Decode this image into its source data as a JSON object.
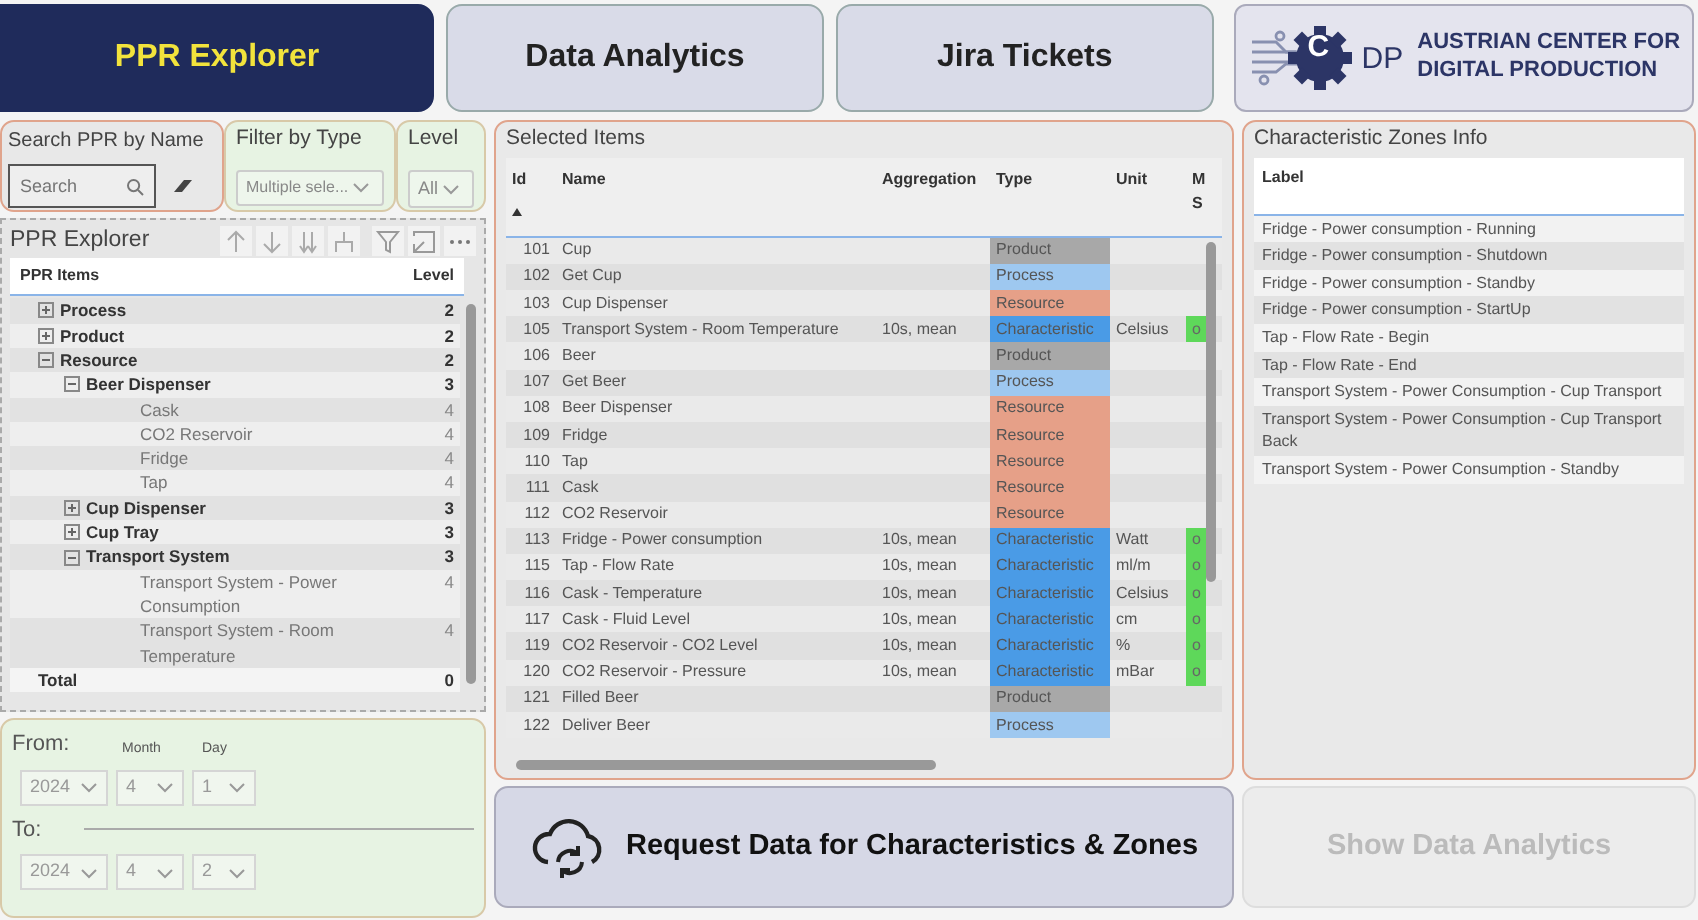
{
  "nav_tabs": [
    {
      "label": "PPR Explorer",
      "selected": true
    },
    {
      "label": "Data Analytics",
      "selected": false
    },
    {
      "label": "Jira Tickets",
      "selected": false
    }
  ],
  "logo": {
    "mark_letter": "C",
    "mark_suffix": "DP",
    "line_1": "AUSTRIAN CENTER FOR",
    "line_2": "DIGITAL PRODUCTION"
  },
  "filters": {
    "search": {
      "title": "Search PPR by Name",
      "placeholder": "Search"
    },
    "type_filter": {
      "title": "Filter by Type",
      "value": "Multiple sele..."
    },
    "level_filter": {
      "title": "Level",
      "value": "All"
    }
  },
  "ppr_explorer": {
    "title": "PPR Explorer",
    "columns": [
      "PPR Items",
      "Level"
    ],
    "rows": [
      {
        "label": "Process",
        "level": "2",
        "expanded": false
      },
      {
        "label": "Product",
        "level": "2",
        "expanded": false
      },
      {
        "label": "Resource",
        "level": "2",
        "expanded": true,
        "children": [
          {
            "label": "Beer Dispenser",
            "level": "3",
            "expanded": true,
            "children": [
              {
                "label": "Cask",
                "level": "4"
              },
              {
                "label": "CO2 Reservoir",
                "level": "4"
              },
              {
                "label": "Fridge",
                "level": "4"
              },
              {
                "label": "Tap",
                "level": "4"
              }
            ]
          },
          {
            "label": "Cup Dispenser",
            "level": "3",
            "expanded": false
          },
          {
            "label": "Cup Tray",
            "level": "3",
            "expanded": false
          },
          {
            "label": "Transport System",
            "level": "3",
            "expanded": true,
            "children": [
              {
                "label": "Transport System - Power Consumption",
                "level": "4"
              },
              {
                "label": "Transport System - Room Temperature",
                "level": "4"
              }
            ]
          }
        ]
      }
    ],
    "total": {
      "label": "Total",
      "level": "0"
    }
  },
  "date_range": {
    "from_label": "From:",
    "month_label": "Month",
    "day_label": "Day",
    "from": {
      "year": "2024",
      "month": "4",
      "day": "1"
    },
    "to_label": "To:",
    "to": {
      "year": "2024",
      "month": "4",
      "day": "2"
    }
  },
  "selected_items": {
    "title": "Selected Items",
    "columns": [
      "Id",
      "Name",
      "Aggregation",
      "Type",
      "Unit",
      "M S"
    ],
    "rows": [
      {
        "id": "101",
        "name": "Cup",
        "type": "Product",
        "kind": "product"
      },
      {
        "id": "102",
        "name": "Get Cup",
        "type": "Process",
        "kind": "process"
      },
      {
        "id": "103",
        "name": "Cup Dispenser",
        "type": "Resource",
        "kind": "resource"
      },
      {
        "id": "105",
        "name": "Transport System - Room Temperature",
        "aggregation": "10s, mean",
        "type": "Characteristic",
        "kind": "characteristic",
        "unit": "Celsius",
        "column_6": "o"
      },
      {
        "id": "106",
        "name": "Beer",
        "type": "Product",
        "kind": "product"
      },
      {
        "id": "107",
        "name": "Get Beer",
        "type": "Process",
        "kind": "process"
      },
      {
        "id": "108",
        "name": "Beer Dispenser",
        "type": "Resource",
        "kind": "resource"
      },
      {
        "id": "109",
        "name": "Fridge",
        "type": "Resource",
        "kind": "resource"
      },
      {
        "id": "110",
        "name": "Tap",
        "type": "Resource",
        "kind": "resource"
      },
      {
        "id": "111",
        "name": "Cask",
        "type": "Resource",
        "kind": "resource"
      },
      {
        "id": "112",
        "name": "CO2 Reservoir",
        "type": "Resource",
        "kind": "resource"
      },
      {
        "id": "113",
        "name": "Fridge - Power consumption",
        "aggregation": "10s, mean",
        "type": "Characteristic",
        "kind": "characteristic",
        "unit": "Watt",
        "column_6": "o"
      },
      {
        "id": "115",
        "name": "Tap - Flow Rate",
        "aggregation": "10s, mean",
        "type": "Characteristic",
        "kind": "characteristic",
        "unit": "ml/m",
        "column_6": "o"
      },
      {
        "id": "116",
        "name": "Cask - Temperature",
        "aggregation": "10s, mean",
        "type": "Characteristic",
        "kind": "characteristic",
        "unit": "Celsius",
        "column_6": "o"
      },
      {
        "id": "117",
        "name": "Cask - Fluid Level",
        "aggregation": "10s, mean",
        "type": "Characteristic",
        "kind": "characteristic",
        "unit": "cm",
        "column_6": "o"
      },
      {
        "id": "119",
        "name": "CO2 Reservoir - CO2 Level",
        "aggregation": "10s, mean",
        "type": "Characteristic",
        "kind": "characteristic",
        "unit": "%",
        "column_6": "o"
      },
      {
        "id": "120",
        "name": "CO2 Reservoir - Pressure",
        "aggregation": "10s, mean",
        "type": "Characteristic",
        "kind": "characteristic",
        "unit": "mBar",
        "column_6": "o"
      },
      {
        "id": "121",
        "name": "Filled Beer",
        "type": "Product",
        "kind": "product"
      },
      {
        "id": "122",
        "name": "Deliver Beer",
        "type": "Process",
        "kind": "process"
      }
    ]
  },
  "zones": {
    "title": "Characteristic Zones Info",
    "columns": [
      "Label"
    ],
    "rows": [
      "Fridge - Power consumption - Running",
      "Fridge - Power consumption - Shutdown",
      "Fridge - Power consumption - Standby",
      "Fridge - Power consumption - StartUp",
      "Tap - Flow Rate - Begin",
      "Tap - Flow Rate - End",
      "Transport System - Power Consumption - Cup Transport",
      "Transport System - Power Consumption - Cup Transport Back",
      "Transport System - Power Consumption - Standby"
    ]
  },
  "request_button": {
    "label": "Request Data for Characteristics & Zones"
  },
  "analytics_button": {
    "label": "Show Data Analytics",
    "disabled": true
  }
}
